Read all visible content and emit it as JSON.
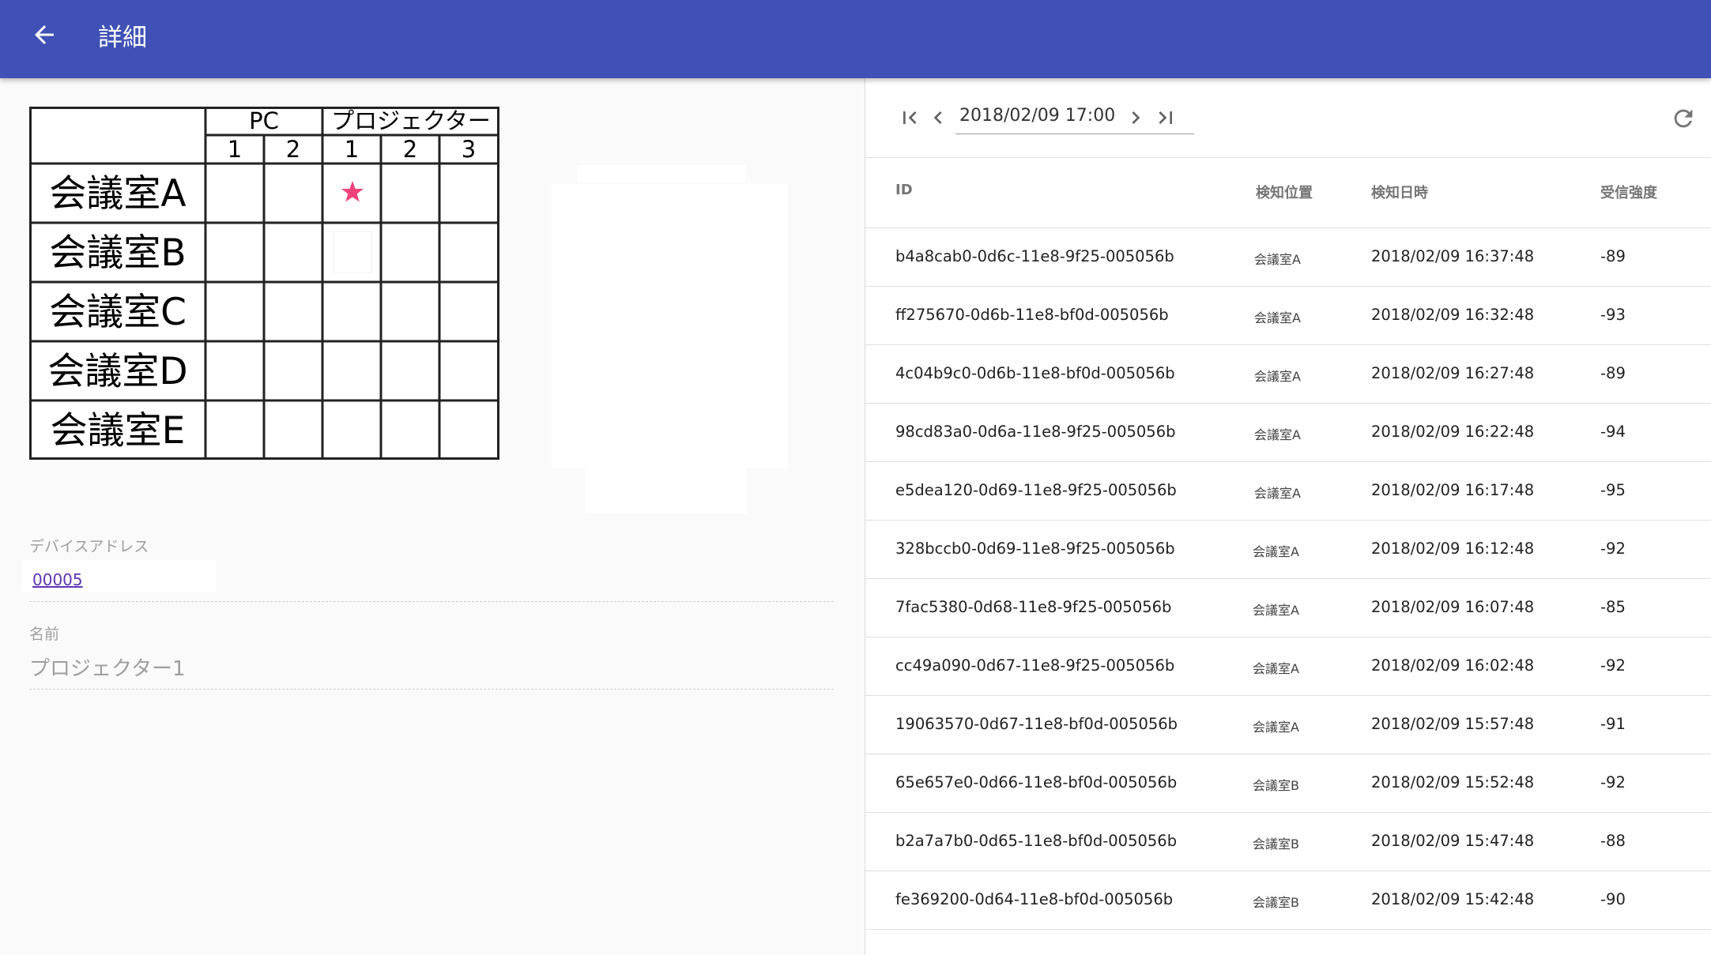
{
  "appbar": {
    "title": "詳細",
    "back_icon": "arrow-back-icon",
    "background_color": "#3f51b5"
  },
  "map": {
    "col_groups": [
      "PC",
      "プロジェクター"
    ],
    "col_numbers": [
      "1",
      "2",
      "1",
      "2",
      "3"
    ],
    "rows": [
      "会議室A",
      "会議室B",
      "会議室C",
      "会議室D",
      "会議室E"
    ],
    "marker_icon": "star-icon",
    "marker_color": "#f0437a"
  },
  "device": {
    "address_label": "デバイスアドレス",
    "address_value": "00005",
    "name_label": "名前",
    "name_value": "プロジェクター1"
  },
  "pager": {
    "first_icon": "first-page-icon",
    "prev_icon": "chevron-left-icon",
    "current": "2018/02/09 17:00",
    "next_icon": "chevron-right-icon",
    "last_icon": "last-page-icon",
    "refresh_icon": "refresh-icon"
  },
  "table": {
    "headers": [
      "ID",
      "検知位置",
      "検知日時",
      "受信強度"
    ],
    "rows": [
      {
        "id": "b4a8cab0-0d6c-11e8-9f25-005056b",
        "position": "会議室A",
        "datetime": "2018/02/09 16:37:48",
        "rssi": "-89"
      },
      {
        "id": "ff275670-0d6b-11e8-bf0d-005056b",
        "position": "会議室A",
        "datetime": "2018/02/09 16:32:48",
        "rssi": "-93"
      },
      {
        "id": "4c04b9c0-0d6b-11e8-bf0d-005056b",
        "position": "会議室A",
        "datetime": "2018/02/09 16:27:48",
        "rssi": "-89"
      },
      {
        "id": "98cd83a0-0d6a-11e8-9f25-005056b",
        "position": "会議室A",
        "datetime": "2018/02/09 16:22:48",
        "rssi": "-94"
      },
      {
        "id": "e5dea120-0d69-11e8-9f25-005056b",
        "position": "会議室A",
        "datetime": "2018/02/09 16:17:48",
        "rssi": "-95"
      },
      {
        "id": "328bccb0-0d69-11e8-9f25-005056b",
        "position": "会議室A",
        "datetime": "2018/02/09 16:12:48",
        "rssi": "-92"
      },
      {
        "id": "7fac5380-0d68-11e8-9f25-005056b",
        "position": "会議室A",
        "datetime": "2018/02/09 16:07:48",
        "rssi": "-85"
      },
      {
        "id": "cc49a090-0d67-11e8-9f25-005056b",
        "position": "会議室A",
        "datetime": "2018/02/09 16:02:48",
        "rssi": "-92"
      },
      {
        "id": "19063570-0d67-11e8-bf0d-005056b",
        "position": "会議室A",
        "datetime": "2018/02/09 15:57:48",
        "rssi": "-91"
      },
      {
        "id": "65e657e0-0d66-11e8-bf0d-005056b",
        "position": "会議室B",
        "datetime": "2018/02/09 15:52:48",
        "rssi": "-92"
      },
      {
        "id": "b2a7a7b0-0d65-11e8-bf0d-005056b",
        "position": "会議室B",
        "datetime": "2018/02/09 15:47:48",
        "rssi": "-88"
      },
      {
        "id": "fe369200-0d64-11e8-bf0d-005056b",
        "position": "会議室B",
        "datetime": "2018/02/09 15:42:48",
        "rssi": "-90"
      }
    ]
  }
}
